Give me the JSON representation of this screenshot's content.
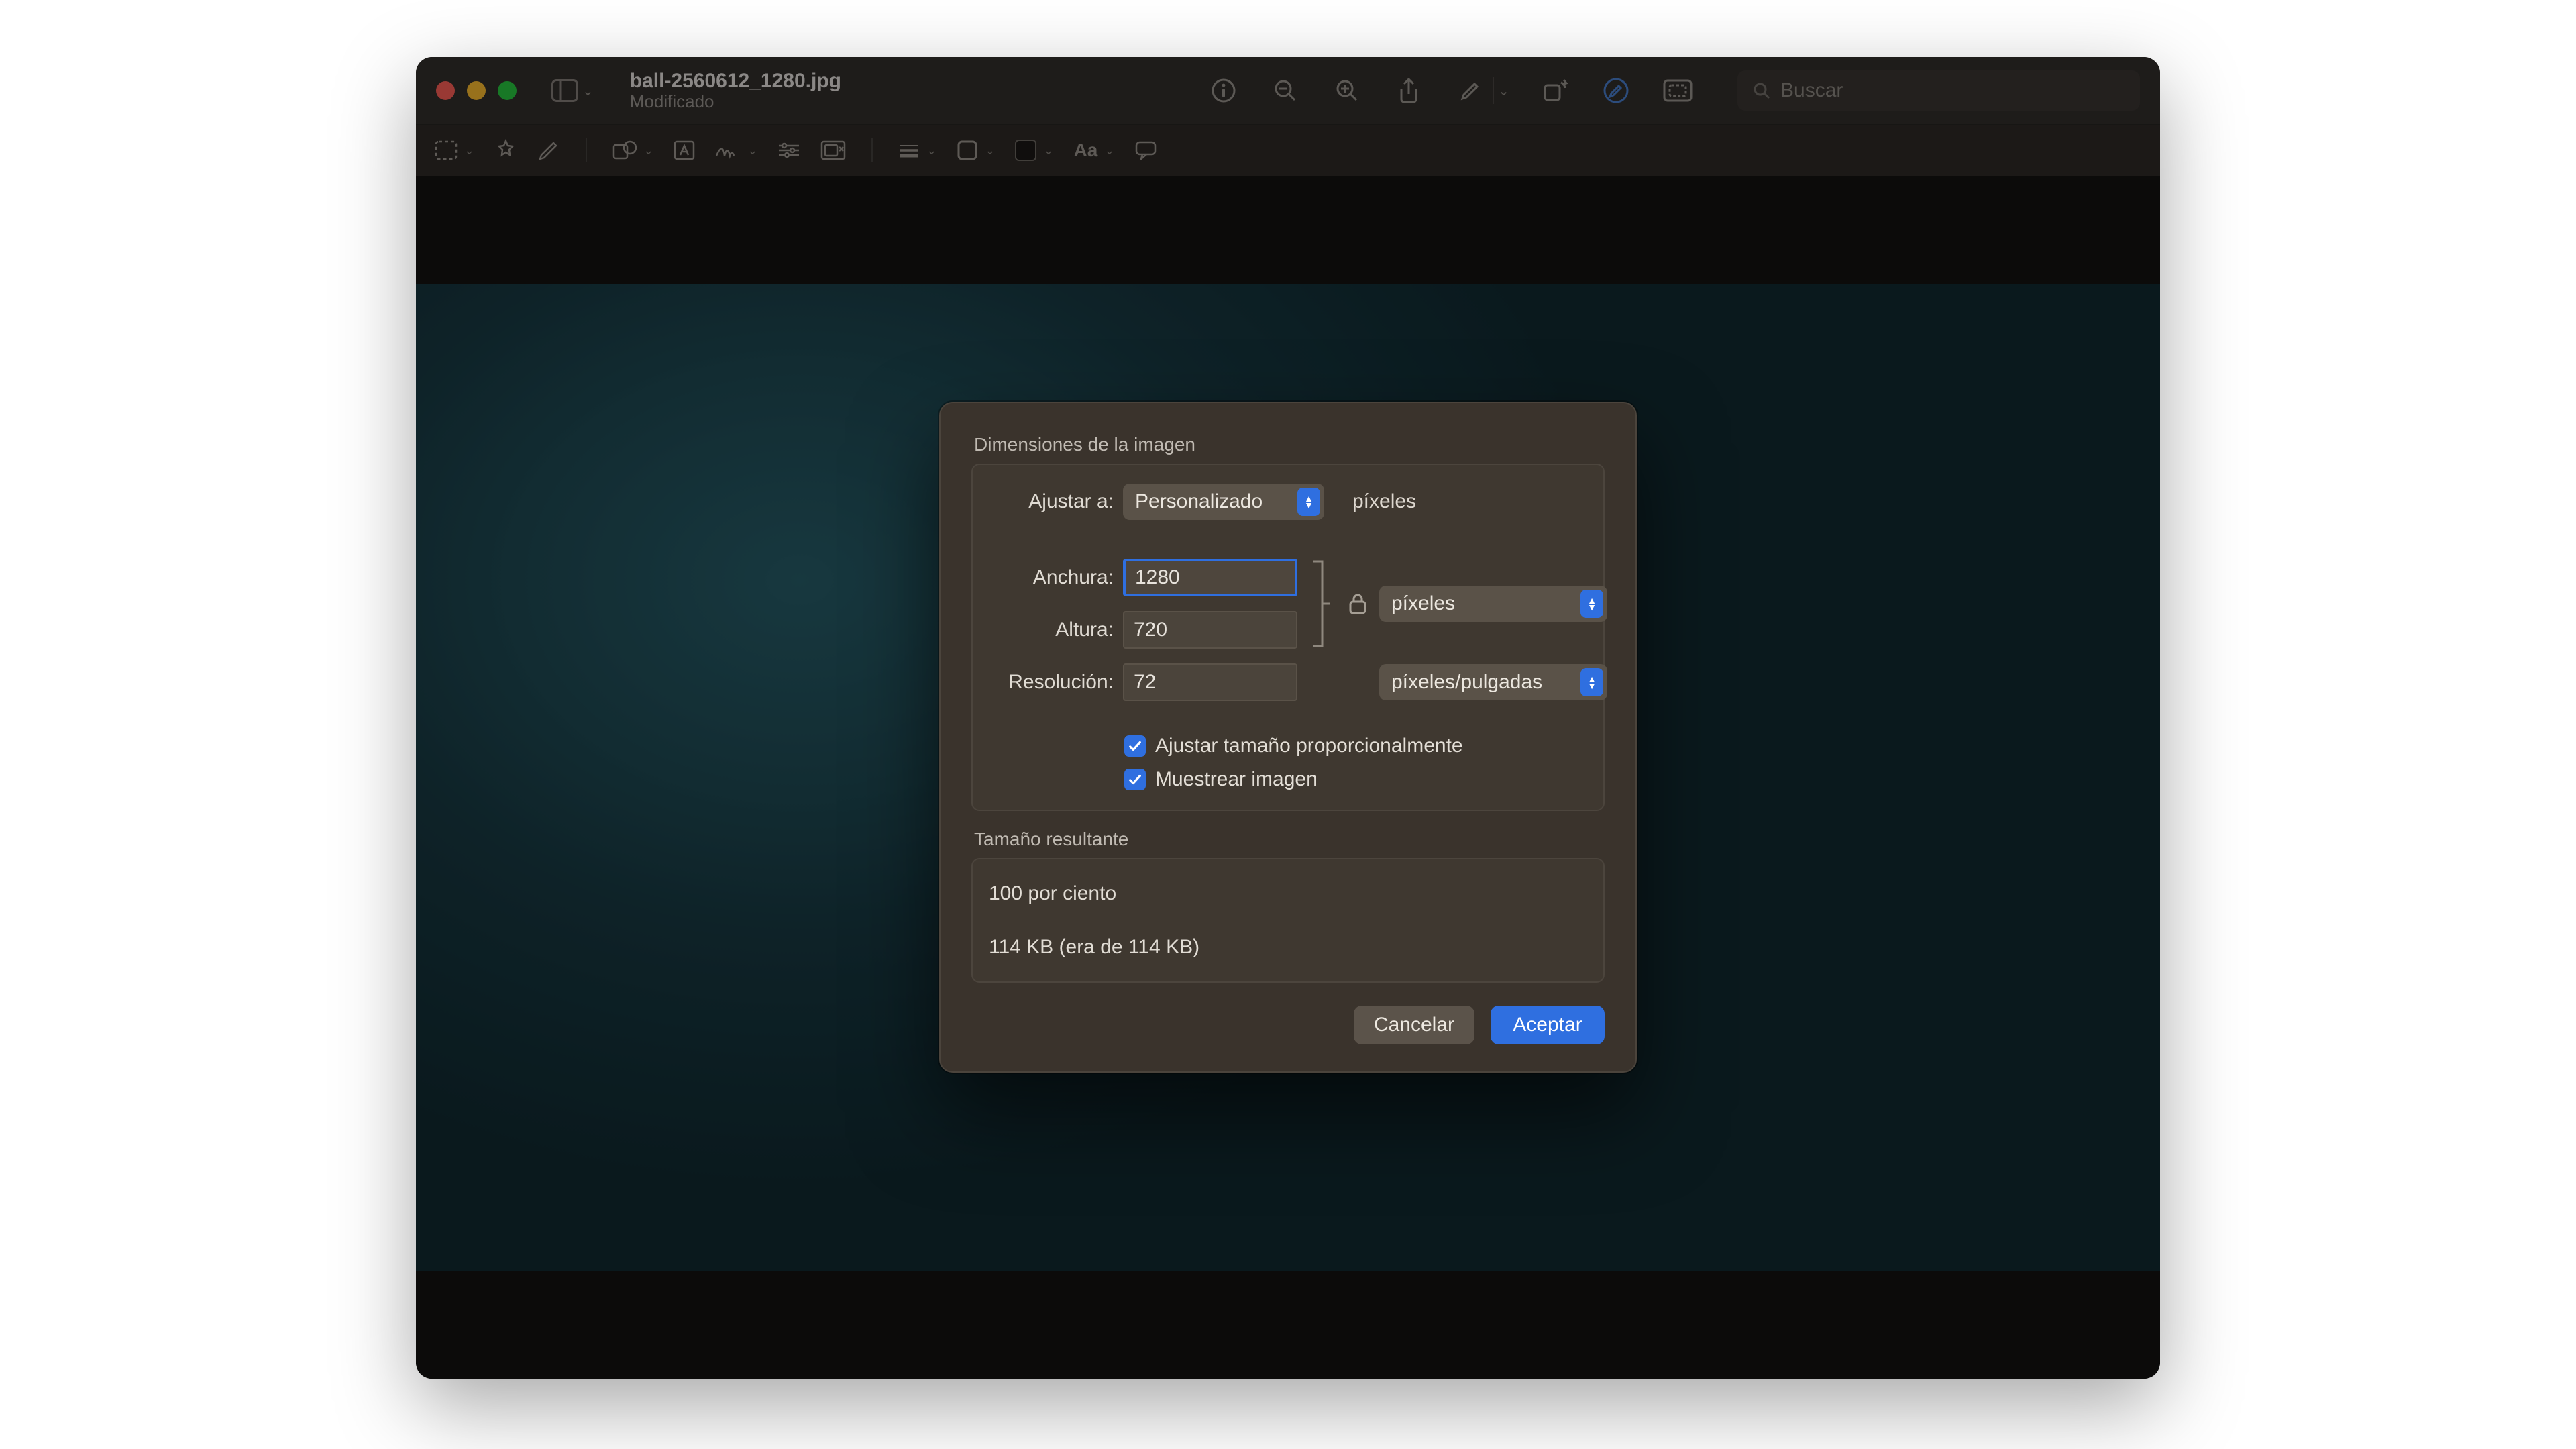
{
  "window": {
    "filename": "ball-2560612_1280.jpg",
    "status": "Modificado"
  },
  "toolbar": {
    "search_placeholder": "Buscar"
  },
  "dialog": {
    "section_dimensions": "Dimensiones de la imagen",
    "fit_label": "Ajustar a:",
    "fit_select": "Personalizado",
    "fit_unit": "píxeles",
    "width_label": "Anchura:",
    "width_value": "1280",
    "height_label": "Altura:",
    "height_value": "720",
    "wh_unit_select": "píxeles",
    "resolution_label": "Resolución:",
    "resolution_value": "72",
    "resolution_unit_select": "píxeles/pulgadas",
    "scale_proportional_label": "Ajustar tamaño proporcionalmente",
    "scale_proportional_checked": true,
    "resample_label": "Muestrear imagen",
    "resample_checked": true,
    "section_result": "Tamaño resultante",
    "result_percent": "100 por ciento",
    "result_size": "114 KB (era de 114 KB)",
    "cancel": "Cancelar",
    "accept": "Aceptar"
  }
}
